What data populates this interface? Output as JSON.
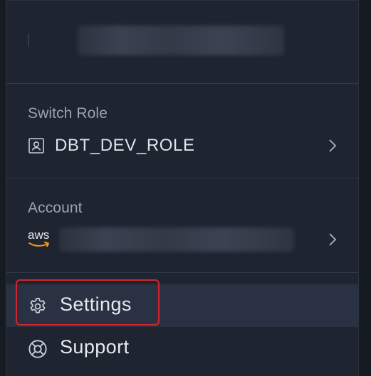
{
  "user": {
    "display_name_hidden": true
  },
  "role": {
    "label": "Switch Role",
    "value": "DBT_DEV_ROLE",
    "icon": "user-badge-icon"
  },
  "account": {
    "label": "Account",
    "provider_logo": "aws",
    "value_hidden": true
  },
  "nav": {
    "settings_label": "Settings",
    "support_label": "Support"
  },
  "colors": {
    "menu_background": "#1e2430",
    "active_item_background": "#2a3142",
    "highlight_border": "#d4252a",
    "label_text": "#9aa3b2",
    "primary_text": "#e6e9ef"
  }
}
